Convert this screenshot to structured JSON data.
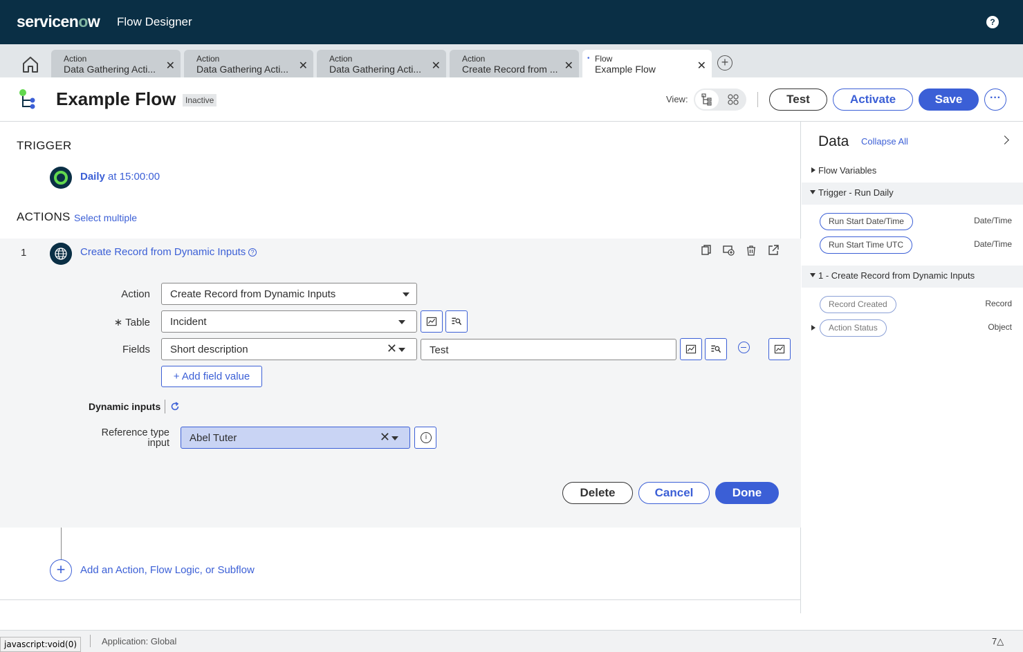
{
  "topbar": {
    "logo_text": "servicenow",
    "app_name": "Flow Designer",
    "help_label": "?"
  },
  "tabs": [
    {
      "type": "Action",
      "name": "Data Gathering Acti...",
      "close": "✕"
    },
    {
      "type": "Action",
      "name": "Data Gathering Acti...",
      "close": "✕"
    },
    {
      "type": "Action",
      "name": "Data Gathering Acti...",
      "close": "✕"
    },
    {
      "type": "Action",
      "name": "Create Record from ...",
      "close": "✕"
    },
    {
      "type": "Flow",
      "name": "Example Flow",
      "close": "✕",
      "dirty": "•"
    }
  ],
  "header": {
    "title": "Example Flow",
    "status": "Inactive",
    "view_label": "View:",
    "test_label": "Test",
    "activate_label": "Activate",
    "save_label": "Save",
    "more_label": "···"
  },
  "trigger": {
    "section_label": "TRIGGER",
    "schedule_bold": "Daily",
    "schedule_rest": " at 15:00:00"
  },
  "actions": {
    "section_label": "ACTIONS",
    "select_multiple": "Select multiple",
    "step": {
      "number": "1",
      "title": "Create Record from Dynamic Inputs",
      "action_label": "Action",
      "action_value": "Create Record from Dynamic Inputs",
      "table_label": "Table",
      "table_required": "∗",
      "table_value": "Incident",
      "fields_label": "Fields",
      "field_name": "Short description",
      "field_value": "Test",
      "add_field_label": "Add field value",
      "dynamic_inputs_label": "Dynamic inputs",
      "ref_label_line1": "Reference type",
      "ref_label_line2": "input",
      "ref_value": "Abel Tuter",
      "delete_label": "Delete",
      "cancel_label": "Cancel",
      "done_label": "Done"
    },
    "add_action_label": "Add an Action, Flow Logic, or Subflow"
  },
  "data_panel": {
    "title": "Data",
    "collapse_all": "Collapse All",
    "flow_variables": "Flow Variables",
    "trigger_group": "Trigger - Run Daily",
    "trigger_pills": [
      {
        "label": "Run Start Date/Time",
        "type": "Date/Time"
      },
      {
        "label": "Run Start Time UTC",
        "type": "Date/Time"
      }
    ],
    "action_group": "1 - Create Record from Dynamic Inputs",
    "action_pills": [
      {
        "label": "Record Created",
        "type": "Record"
      },
      {
        "label": "Action Status",
        "type": "Object"
      }
    ]
  },
  "footer": {
    "status_url": "javascript:void(0)",
    "application": "Application: Global",
    "count": "7"
  },
  "colors": {
    "topbar": "#0a2f45",
    "accent": "#3b5fd6",
    "trigger_green": "#62d84e"
  }
}
